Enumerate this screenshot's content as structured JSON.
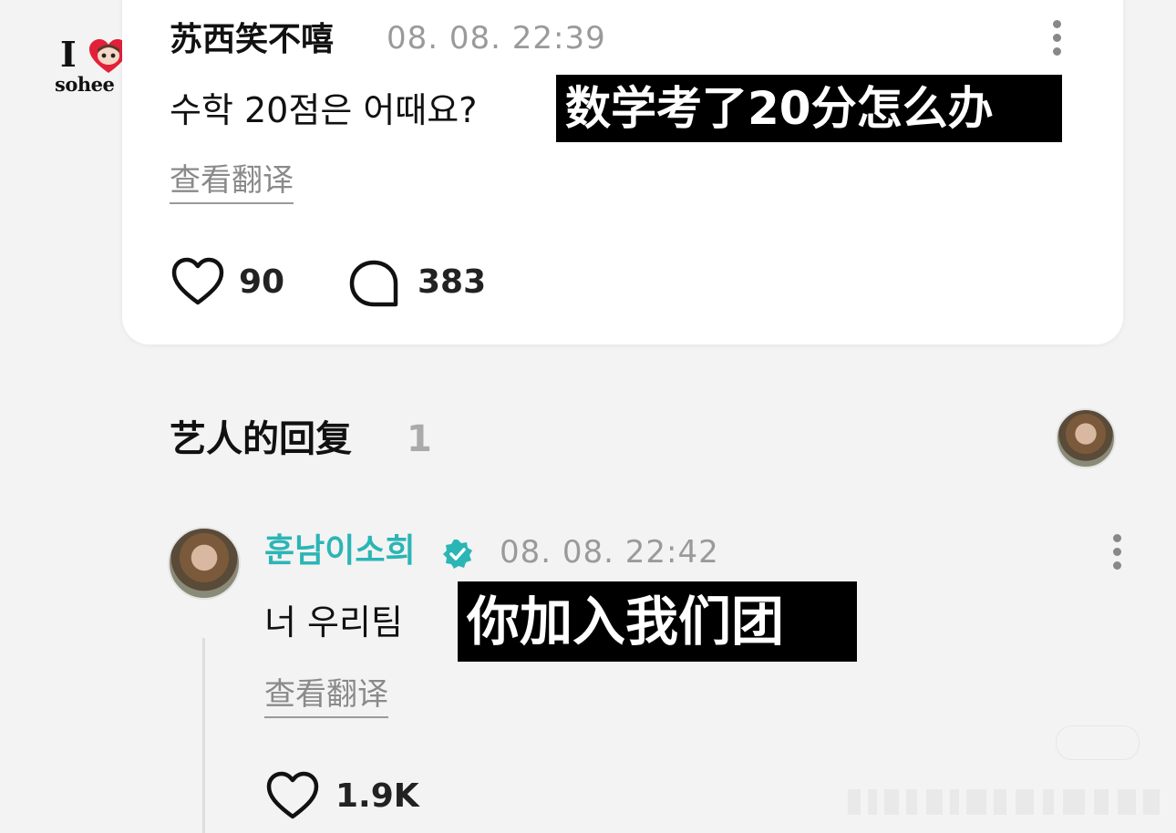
{
  "logo": {
    "word_i": "I",
    "word_brand": "sohee"
  },
  "post": {
    "username": "苏西笑不嘻",
    "timestamp": "08. 08. 22:39",
    "text": "수학 20점은 어때요?",
    "caption": "数学考了20分怎么办",
    "translate_label": "查看翻译",
    "likes": "90",
    "comments": "383"
  },
  "artist_section": {
    "title": "艺人的回复",
    "count": "1"
  },
  "reply": {
    "username": "훈남이소희",
    "timestamp": "08. 08. 22:42",
    "text": "너 우리팀",
    "caption": "你加入我们团",
    "translate_label": "查看翻译",
    "likes": "1.9K"
  },
  "colors": {
    "artist_name": "#2bb5b5",
    "verified": "#2bb5b5",
    "background": "#f3f3f4"
  },
  "icons": [
    "heart-icon",
    "comment-bubble-icon",
    "more-vertical-icon",
    "verified-badge-icon",
    "logo-heart"
  ]
}
